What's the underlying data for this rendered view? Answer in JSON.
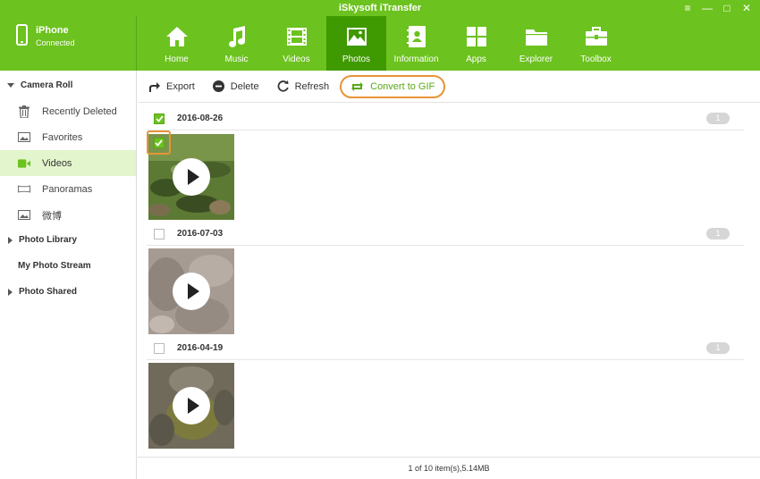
{
  "window": {
    "title": "iSkysoft iTransfer",
    "controls": [
      "≡",
      "—",
      "□",
      "✕"
    ]
  },
  "device": {
    "name": "iPhone",
    "status": "Connected"
  },
  "nav": {
    "items": [
      {
        "label": "Home",
        "icon": "home-icon",
        "active": false
      },
      {
        "label": "Music",
        "icon": "music-icon",
        "active": false
      },
      {
        "label": "Videos",
        "icon": "film-icon",
        "active": false
      },
      {
        "label": "Photos",
        "icon": "photo-icon",
        "active": true
      },
      {
        "label": "Information",
        "icon": "contacts-icon",
        "active": false
      },
      {
        "label": "Apps",
        "icon": "apps-icon",
        "active": false
      },
      {
        "label": "Explorer",
        "icon": "folder-icon",
        "active": false
      },
      {
        "label": "Toolbox",
        "icon": "toolbox-icon",
        "active": false
      }
    ]
  },
  "sidebar": {
    "camera_roll": "Camera Roll",
    "items": [
      {
        "label": "Recently Deleted",
        "icon": "trash-icon"
      },
      {
        "label": "Favorites",
        "icon": "image-icon"
      },
      {
        "label": "Videos",
        "icon": "video-icon",
        "active": true
      },
      {
        "label": "Panoramas",
        "icon": "panorama-icon"
      },
      {
        "label": "微博",
        "icon": "image-icon"
      }
    ],
    "photo_library": "Photo Library",
    "my_photo_stream": "My Photo Stream",
    "photo_shared": "Photo Shared"
  },
  "toolbar": {
    "export": "Export",
    "delete": "Delete",
    "refresh": "Refresh",
    "convert_gif": "Convert to GIF"
  },
  "groups": [
    {
      "date": "2016-08-26",
      "count": "1",
      "checked": true
    },
    {
      "date": "2016-07-03",
      "count": "1",
      "checked": false
    },
    {
      "date": "2016-04-19",
      "count": "1",
      "checked": false
    }
  ],
  "status": "1 of 10 item(s),5.14MB",
  "colors": {
    "brand_green": "#6cc21e",
    "active_nav": "#3f9900",
    "highlight_orange": "#e79438"
  }
}
